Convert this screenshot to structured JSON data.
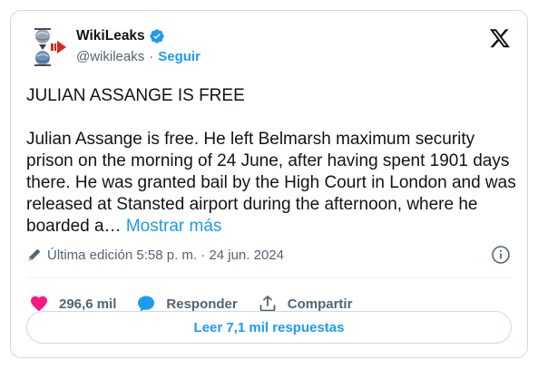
{
  "author": {
    "display_name": "WikiLeaks",
    "handle": "@wikileaks",
    "separator": "·",
    "follow_label": "Seguir",
    "verified_color": "#1d9bf0"
  },
  "tweet": {
    "headline": "JULIAN ASSANGE IS FREE",
    "body": "Julian Assange is free. He left Belmarsh maximum security prison on the morning of 24 June, after having spent 1901 days there. He was granted bail by the High Court in London and was released at Stansted airport during the afternoon, where he boarded a…",
    "show_more_label": "Mostrar más"
  },
  "edit_info": {
    "text": "Última edición 5:58 p. m. · 24 jun. 2024"
  },
  "actions": {
    "likes_count": "296,6 mil",
    "reply_label": "Responder",
    "share_label": "Compartir"
  },
  "replies_button_label": "Leer 7,1 mil respuestas",
  "colors": {
    "accent": "#1d9bf0",
    "like": "#f91880",
    "text": "#0f1419",
    "muted": "#536471",
    "border": "#cfd9de"
  },
  "icons": [
    "wikileaks-logo-icon",
    "verified-badge-icon",
    "x-logo-icon",
    "pencil-icon",
    "info-icon",
    "heart-icon",
    "reply-bubble-icon",
    "share-icon"
  ]
}
